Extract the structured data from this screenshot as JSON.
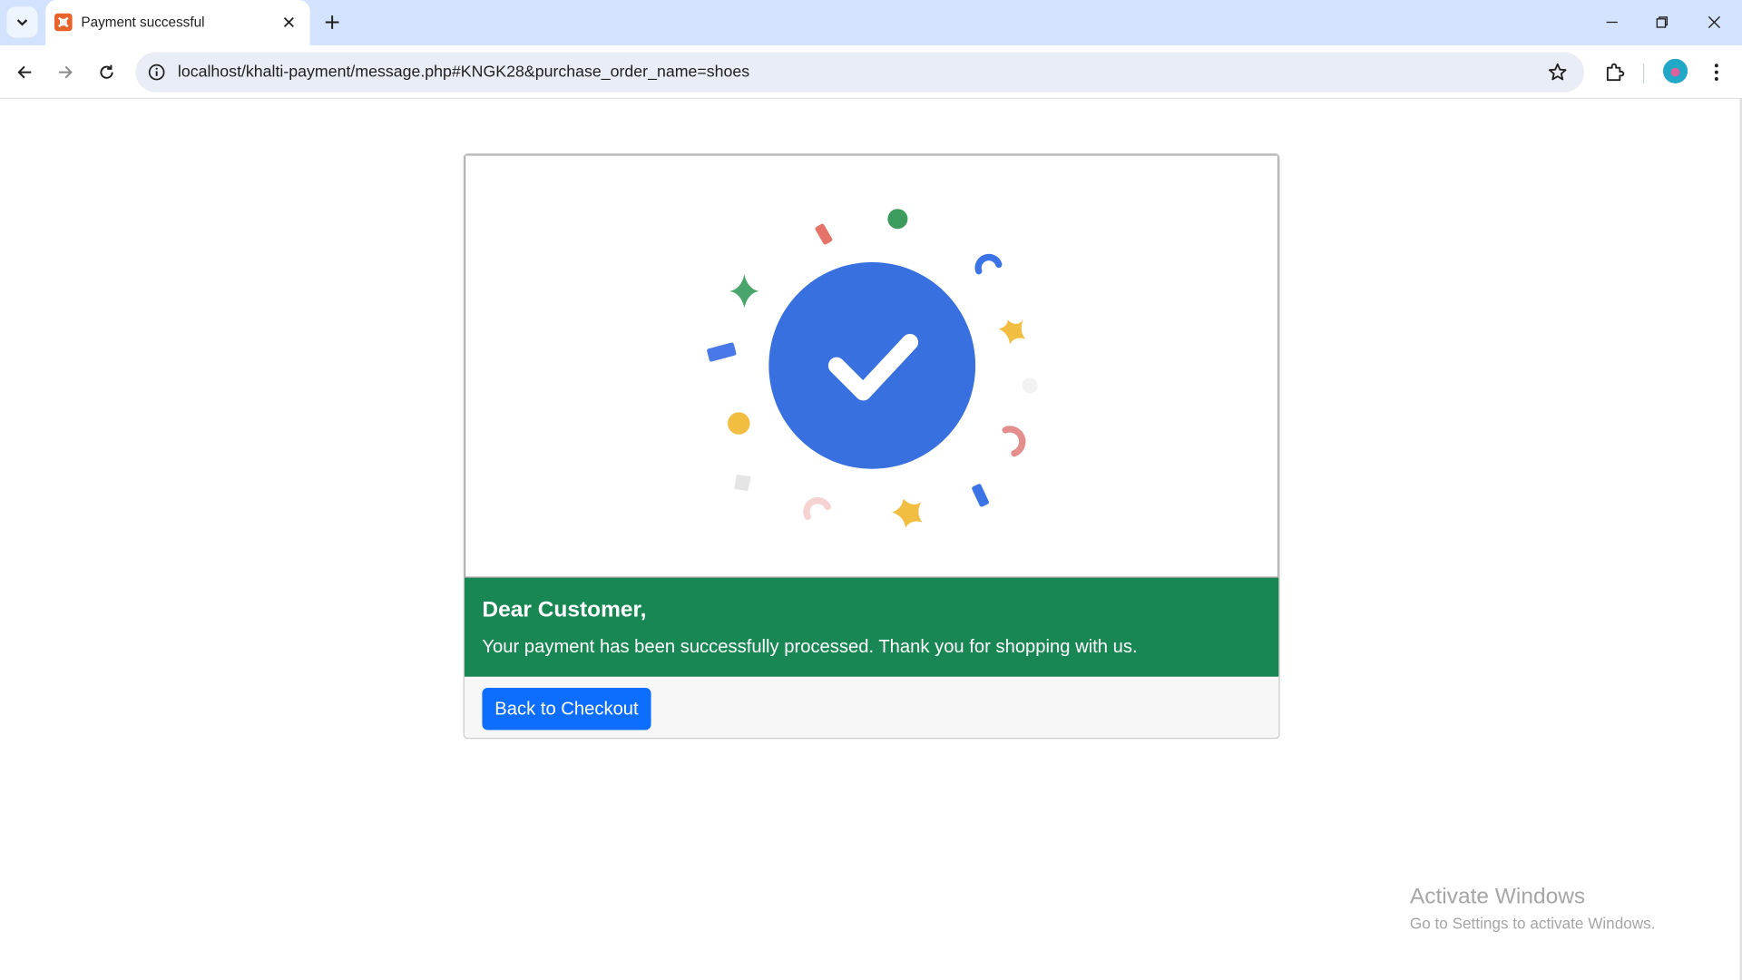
{
  "browser": {
    "tab": {
      "title": "Payment successful",
      "favicon": "xampp-favicon-icon"
    },
    "new_tab_icon": "plus-icon",
    "url": "localhost/khalti-payment/message.php#KNGK28&purchase_order_name=shoes",
    "icons": {
      "back": "back-arrow-icon",
      "forward": "forward-arrow-icon",
      "reload": "reload-icon",
      "site_info": "info-icon",
      "bookmark": "star-icon",
      "extensions": "puzzle-icon",
      "menu": "kebab-menu-icon"
    }
  },
  "page": {
    "alert": {
      "heading": "Dear Customer,",
      "message": "Your payment has been successfully processed. Thank you for shopping with us."
    },
    "button": {
      "label": "Back to Checkout"
    },
    "illustration": "success-checkmark-icon",
    "colors": {
      "success_green": "#198754",
      "primary_blue": "#0d6efd",
      "check_circle": "#3870e0"
    }
  },
  "os_watermark": {
    "title": "Activate Windows",
    "subtitle": "Go to Settings to activate Windows."
  }
}
